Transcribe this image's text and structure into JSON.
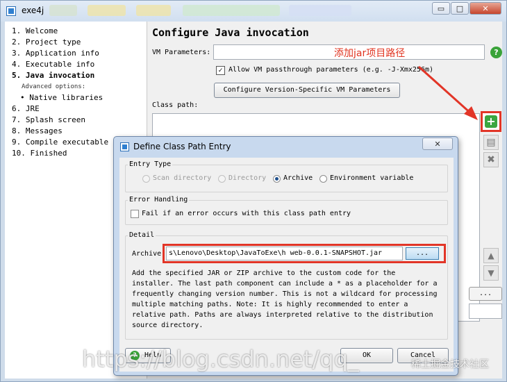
{
  "window": {
    "title": "exe4j",
    "minimize_glyph": "▭",
    "maximize_glyph": "□",
    "close_glyph": "✕"
  },
  "sidebar": {
    "steps": [
      {
        "label": "1.  Welcome"
      },
      {
        "label": "2.  Project type"
      },
      {
        "label": "3.  Application info"
      },
      {
        "label": "4.  Executable info"
      },
      {
        "label": "5.  Java invocation",
        "active": true
      },
      {
        "label": "Advanced options:",
        "sub": true
      },
      {
        "label": "• Native libraries"
      },
      {
        "label": "6.  JRE"
      },
      {
        "label": "7.  Splash screen"
      },
      {
        "label": "8.  Messages"
      },
      {
        "label": "9.  Compile executable"
      },
      {
        "label": "10.  Finished"
      }
    ]
  },
  "content": {
    "title": "Configure Java invocation",
    "vm_parameters_label": "VM Parameters:",
    "vm_parameters_value": "",
    "annotation": "添加jar项目路径",
    "help_glyph": "?",
    "allow_passthrough_label": "Allow VM passthrough parameters (e.g. -J-Xmx256m)",
    "allow_passthrough_checked": "✓",
    "version_button": "Configure Version-Specific VM Parameters",
    "classpath_label": "Class path:",
    "add_glyph": "+",
    "edit_glyph": "▤",
    "remove_glyph": "✖",
    "up_glyph": "▲",
    "down_glyph": "▼",
    "bg_button": "..."
  },
  "dialog": {
    "title": "Define Class Path Entry",
    "close_glyph": "✕",
    "entry_type_title": "Entry Type",
    "entry_types": [
      {
        "label": "Scan directory",
        "disabled": true
      },
      {
        "label": "Directory",
        "disabled": true
      },
      {
        "label": "Archive",
        "checked": true
      },
      {
        "label": "Environment variable"
      }
    ],
    "error_handling_title": "Error Handling",
    "fail_label": "Fail if an error occurs with this class path entry",
    "detail_title": "Detail",
    "archive_label": "Archive",
    "archive_value": "s\\Lenovo\\Desktop\\JavaToExe\\h      web-0.0.1-SNAPSHOT.jar",
    "browse_button": "...",
    "detail_text": "Add the specified JAR or ZIP archive to the custom code for the\ninstaller. The last path component can include a * as a placeholder for a\nfrequently changing version number. This is not a wildcard for processing\nmultiple matching paths. Note: It is highly recommended to enter a\nrelative path. Paths are always interpreted relative to the distribution\nsource directory.",
    "help_button": "Help",
    "help_glyph": "?",
    "ok_button": "OK",
    "cancel_button": "Cancel"
  },
  "watermark": {
    "text": "https://blog.csdn.net/qq_",
    "text2": "稀土掘金技术社区"
  },
  "colors": {
    "annotation_red": "#e23527",
    "help_green": "#3aa339",
    "window_frame": "#cfdcea"
  }
}
